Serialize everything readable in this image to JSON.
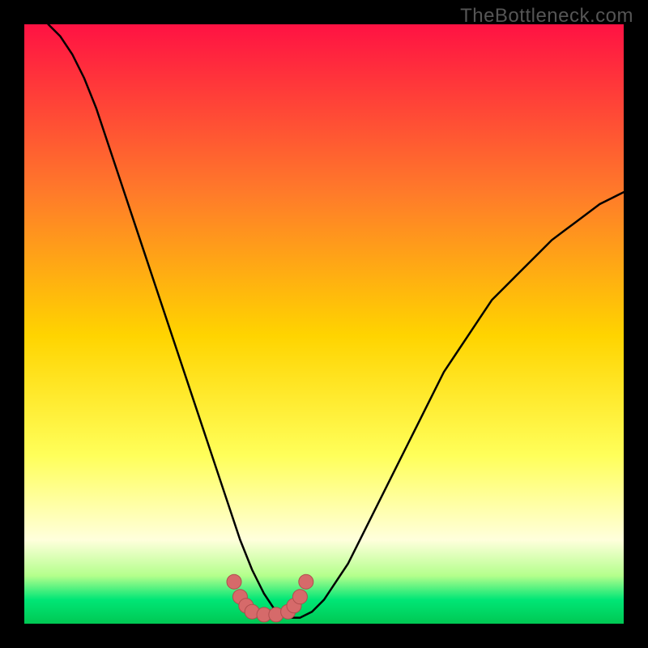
{
  "watermark": "TheBottleneck.com",
  "colors": {
    "bg": "#000000",
    "grad_top": "#ff1243",
    "grad_mid1": "#ff7a2a",
    "grad_mid2": "#ffd400",
    "grad_mid3": "#ffff5a",
    "grad_pale": "#ffffdc",
    "grad_green1": "#b4ff8c",
    "grad_green2": "#00e676",
    "grad_green3": "#00c853",
    "line": "#000000",
    "dot_fill": "#d66a6a",
    "dot_stroke": "#b04e4e"
  },
  "chart_data": {
    "type": "line",
    "title": "",
    "xlabel": "",
    "ylabel": "",
    "xlim": [
      0,
      100
    ],
    "ylim": [
      0,
      100
    ],
    "x": [
      4,
      6,
      8,
      10,
      12,
      14,
      16,
      18,
      20,
      22,
      24,
      26,
      28,
      30,
      32,
      34,
      36,
      38,
      40,
      42,
      44,
      46,
      48,
      50,
      52,
      54,
      56,
      58,
      60,
      62,
      64,
      66,
      68,
      70,
      72,
      74,
      76,
      78,
      80,
      82,
      84,
      86,
      88,
      90,
      92,
      94,
      96,
      98,
      100
    ],
    "y": [
      100,
      98,
      95,
      91,
      86,
      80,
      74,
      68,
      62,
      56,
      50,
      44,
      38,
      32,
      26,
      20,
      14,
      9,
      5,
      2,
      1,
      1,
      2,
      4,
      7,
      10,
      14,
      18,
      22,
      26,
      30,
      34,
      38,
      42,
      45,
      48,
      51,
      54,
      56,
      58,
      60,
      62,
      64,
      65.5,
      67,
      68.5,
      70,
      71,
      72
    ],
    "markers": {
      "x": [
        35,
        36,
        37,
        38,
        40,
        42,
        44,
        45,
        46,
        47
      ],
      "y": [
        7,
        4.5,
        3,
        2,
        1.5,
        1.5,
        2,
        3,
        4.5,
        7
      ]
    },
    "grid": false,
    "legend": false
  }
}
